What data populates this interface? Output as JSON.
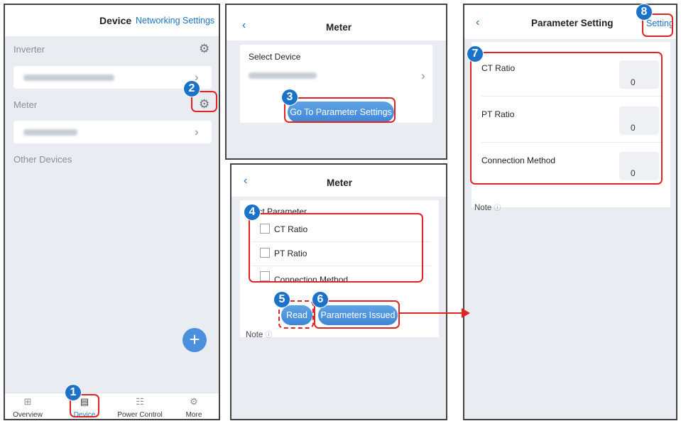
{
  "panel1": {
    "header_title": "Device",
    "header_link": "Networking Settings",
    "section_inverter": "Inverter",
    "section_meter": "Meter",
    "section_other": "Other Devices",
    "nav": [
      {
        "label": "Overview",
        "icon": "grid-icon"
      },
      {
        "label": "Device",
        "icon": "device-icon",
        "active": true
      },
      {
        "label": "Power Control",
        "icon": "power-control-icon"
      },
      {
        "label": "More",
        "icon": "gear-icon"
      }
    ]
  },
  "panel2": {
    "title": "Meter",
    "select_device_label": "Select Device",
    "go_button": "Go To Parameter Settings"
  },
  "panel3": {
    "title": "Meter",
    "select_parameter_label": "lect Parameter",
    "options": [
      "CT Ratio",
      "PT Ratio",
      "Connection Method"
    ],
    "read_button": "Read",
    "issue_button": "Parameters Issued",
    "note": "Note"
  },
  "panel4": {
    "title": "Parameter Setting",
    "setting_link": "Setting",
    "params": [
      {
        "label": "CT Ratio",
        "value": "0"
      },
      {
        "label": "PT Ratio",
        "value": "0"
      },
      {
        "label": "Connection Method",
        "value": "0"
      }
    ],
    "note": "Note"
  },
  "markers": [
    "1",
    "2",
    "3",
    "4",
    "5",
    "6",
    "7",
    "8"
  ],
  "colors": {
    "accent": "#1a73c9",
    "highlight": "#e02424",
    "button": "#4a90dc"
  }
}
